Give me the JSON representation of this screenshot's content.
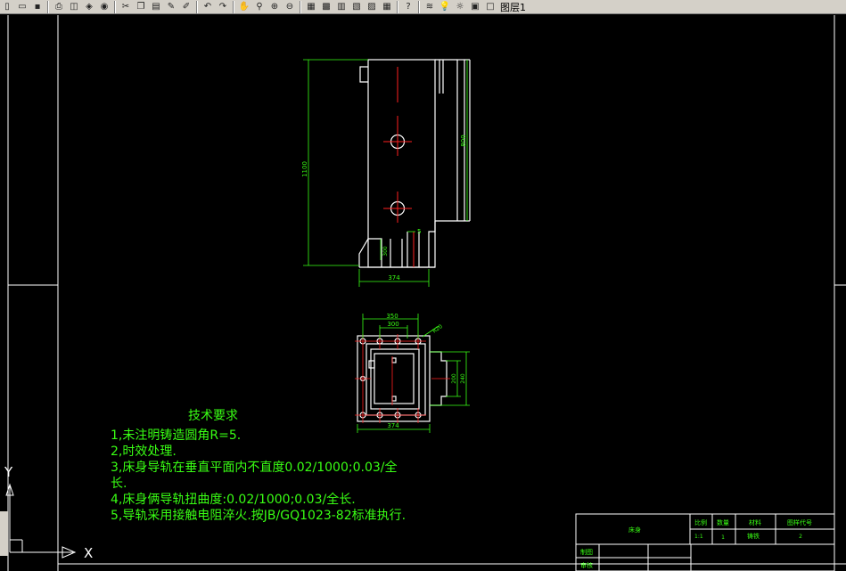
{
  "toolbar": {
    "buttons": [
      "new-icon",
      "open-icon",
      "save-icon",
      "print-icon",
      "preview-icon",
      "publish-icon",
      "plot-icon",
      "cut-icon",
      "copy-icon",
      "paste-icon",
      "matchprop-icon",
      "brush-icon",
      "undo-icon",
      "redo-icon",
      "pan-icon",
      "zoom-realtime-icon",
      "zoom-window-icon",
      "zoom-previous-icon",
      "properties-icon",
      "designcenter-icon",
      "toolpalettes-icon",
      "sheetset-icon",
      "markup-icon",
      "calculator-icon",
      "help-icon",
      "layers-icon"
    ],
    "layer_name": "图层1"
  },
  "drawing": {
    "front_view": {
      "dim_height_left": "1100",
      "dim_height_right": "800",
      "dim_small": "5",
      "dim_vertical_small": "300",
      "dim_width": "374"
    },
    "top_view": {
      "dim_350": "350",
      "dim_300": "300",
      "dim_r": "R20",
      "dim_200": "200",
      "dim_240": "240",
      "dim_374": "374"
    }
  },
  "notes": {
    "title": "技术要求",
    "lines": [
      "1,未注明铸造圆角R=5.",
      "2,时效处理.",
      "3,床身导轨在垂直平面内不直度0.02/1000;0.03/全",
      "长.",
      "4,床身俩导轨扭曲度:0.02/1000;0.03/全长.",
      "5,导轨采用接触电阻淬火.按JB/GQ1023-82标准执行."
    ]
  },
  "title_block": {
    "name": "床身",
    "scale_label": "比例",
    "qty_label": "数量",
    "material_label": "材料",
    "drawing_no_label": "图样代号",
    "scale_value": "1:1",
    "qty_value": "1",
    "material_value": "铸铁",
    "drawing_no_value": "2",
    "drawn_label": "制图",
    "checked_label": "审核"
  },
  "ucs": {
    "x_label": "X",
    "y_label": "Y"
  },
  "colors": {
    "background": "#000000",
    "geometry": "#ffffff",
    "dimension": "#39ff14",
    "centerline": "#ff2020"
  }
}
